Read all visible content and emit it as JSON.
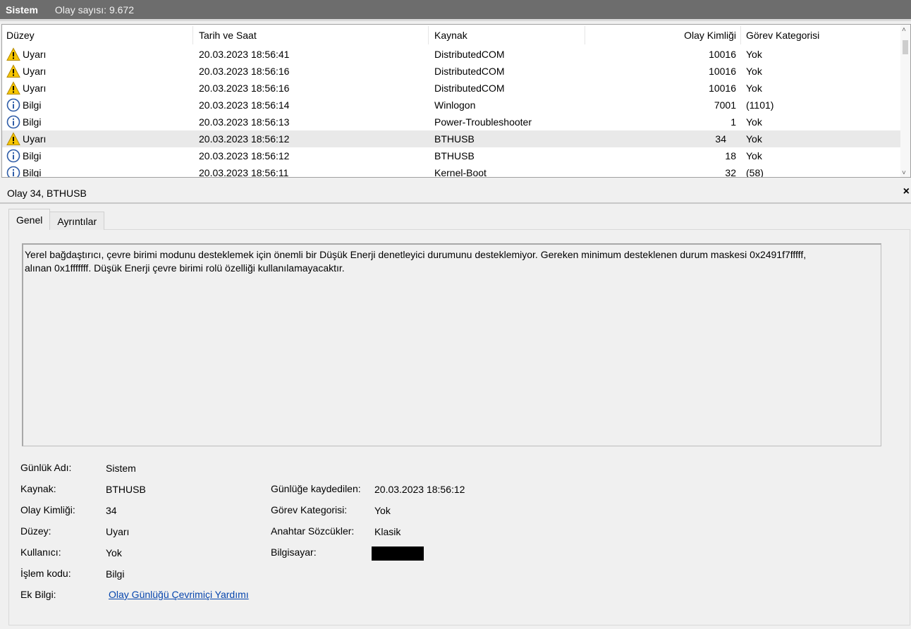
{
  "titlebar": {
    "log_name": "Sistem",
    "event_count": "Olay sayısı: 9.672"
  },
  "grid": {
    "columns": [
      "Düzey",
      "Tarih ve Saat",
      "Kaynak",
      "Olay Kimliği",
      "Görev Kategorisi"
    ],
    "rows": [
      {
        "level_icon": "warning-icon",
        "level": "Uyarı",
        "datetime": "20.03.2023 18:56:41",
        "source": "DistributedCOM",
        "event_id": "10016",
        "category": "Yok"
      },
      {
        "level_icon": "warning-icon",
        "level": "Uyarı",
        "datetime": "20.03.2023 18:56:16",
        "source": "DistributedCOM",
        "event_id": "10016",
        "category": "Yok"
      },
      {
        "level_icon": "warning-icon",
        "level": "Uyarı",
        "datetime": "20.03.2023 18:56:16",
        "source": "DistributedCOM",
        "event_id": "10016",
        "category": "Yok"
      },
      {
        "level_icon": "info-icon",
        "level": "Bilgi",
        "datetime": "20.03.2023 18:56:14",
        "source": "Winlogon",
        "event_id": "7001",
        "category": "(1101)"
      },
      {
        "level_icon": "info-icon",
        "level": "Bilgi",
        "datetime": "20.03.2023 18:56:13",
        "source": "Power-Troubleshooter",
        "event_id": "1",
        "category": "Yok"
      },
      {
        "level_icon": "warning-icon",
        "level": "Uyarı",
        "datetime": "20.03.2023 18:56:12",
        "source": "BTHUSB",
        "event_id": "34",
        "category": "Yok"
      },
      {
        "level_icon": "info-icon",
        "level": "Bilgi",
        "datetime": "20.03.2023 18:56:12",
        "source": "BTHUSB",
        "event_id": "18",
        "category": "Yok"
      },
      {
        "level_icon": "info-icon",
        "level": "Bilgi",
        "datetime": "20.03.2023 18:56:11",
        "source": "Kernel-Boot",
        "event_id": "32",
        "category": "(58)"
      }
    ]
  },
  "detail": {
    "title": "Olay 34, BTHUSB",
    "close_glyph": "×",
    "tabs": [
      "Genel",
      "Ayrıntılar"
    ],
    "description_line1": "Yerel bağdaştırıcı, çevre birimi modunu desteklemek için önemli bir Düşük Enerji denetleyici durumunu desteklemiyor.  Gereken minimum desteklenen durum maskesi 0x2491f7fffff,",
    "description_line2": "alınan 0x1fffffff.  Düşük Enerji çevre birimi rolü özelliği kullanılamayacaktır.",
    "fields": {
      "log_name_label": "Günlük Adı:",
      "log_name": "Sistem",
      "source_label": "Kaynak:",
      "source": "BTHUSB",
      "event_id_label": "Olay Kimliği:",
      "event_id": "34",
      "level_label": "Düzey:",
      "level": "Uyarı",
      "user_label": "Kullanıcı:",
      "user": "Yok",
      "opcode_label": "İşlem kodu:",
      "opcode": "Bilgi",
      "more_info_label": "Ek Bilgi:",
      "more_info_link": "Olay Günlüğü Çevrimiçi Yardımı",
      "logged_label": "Günlüğe kaydedilen:",
      "logged": "20.03.2023 18:56:12",
      "task_category_label": "Görev Kategorisi:",
      "task_category": "Yok",
      "keywords_label": "Anahtar Sözcükler:",
      "keywords": "Klasik",
      "computer_label": "Bilgisayar:"
    }
  }
}
